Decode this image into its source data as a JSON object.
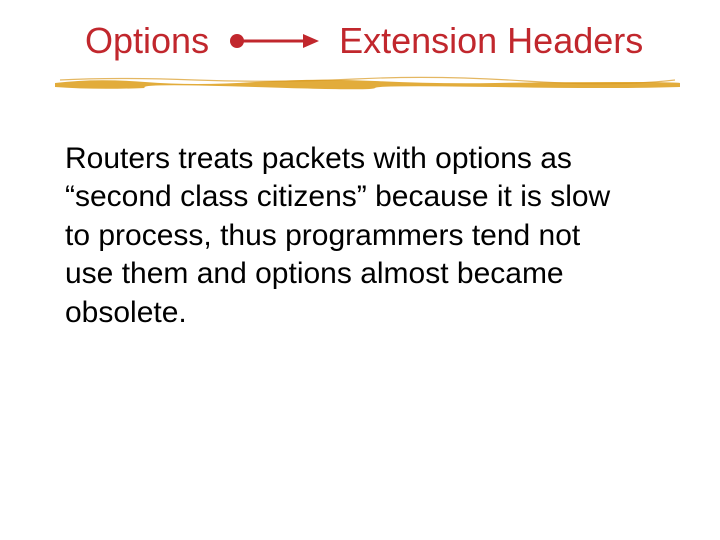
{
  "title": {
    "left": "Options",
    "right": "Extension Headers"
  },
  "body": "Routers treats packets with options as “second class citizens” because it is slow to process, thus programmers tend not use them and options almost became obsolete.",
  "colors": {
    "title": "#c1272d",
    "underline": "#e0a830",
    "body": "#000000"
  }
}
